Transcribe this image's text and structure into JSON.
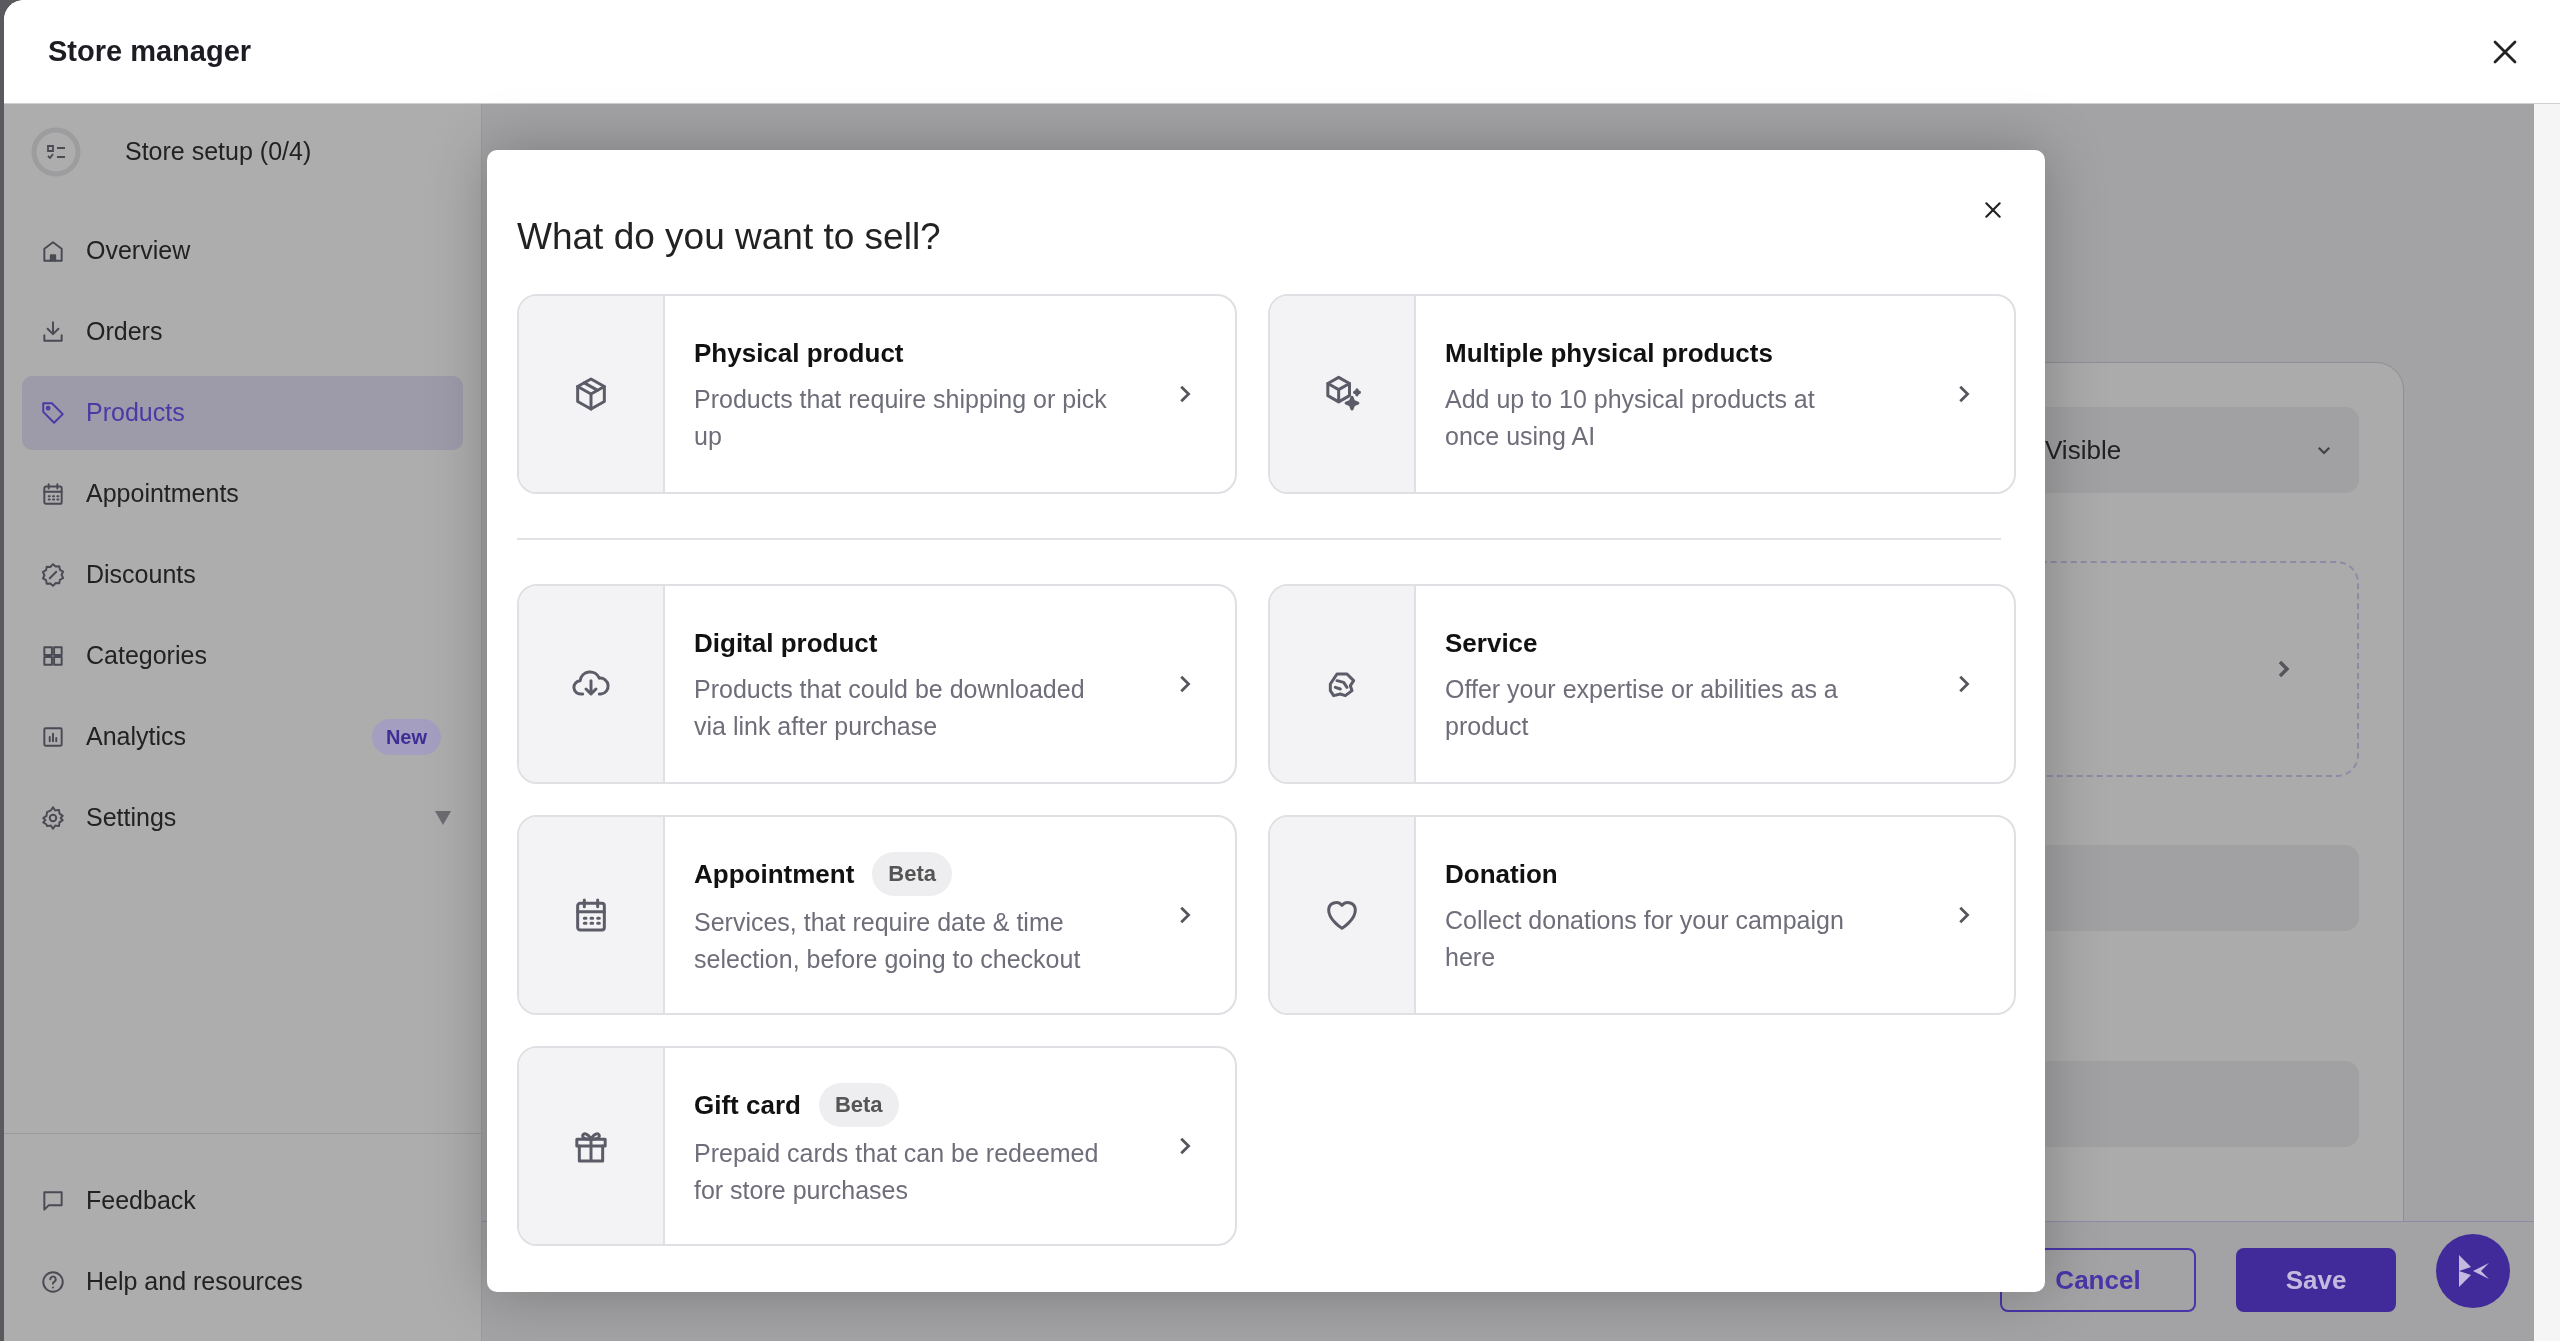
{
  "window": {
    "title": "Store manager"
  },
  "sidebar": {
    "setup": "Store setup (0/4)",
    "items": [
      {
        "label": "Overview",
        "selected": false
      },
      {
        "label": "Orders",
        "selected": false
      },
      {
        "label": "Products",
        "selected": true
      },
      {
        "label": "Appointments",
        "selected": false
      },
      {
        "label": "Discounts",
        "selected": false
      },
      {
        "label": "Categories",
        "selected": false
      },
      {
        "label": "Analytics",
        "selected": false,
        "badge": "New"
      },
      {
        "label": "Settings",
        "selected": false,
        "submenu": true
      }
    ],
    "footer_items": [
      {
        "label": "Feedback"
      },
      {
        "label": "Help and resources"
      }
    ]
  },
  "background": {
    "visibility_select": "Visible",
    "buttons": [
      "Cancel",
      "Save"
    ]
  },
  "modal": {
    "title": "What do you want to sell?",
    "options": [
      {
        "title": "Physical product",
        "description": "Products that require shipping or pick up"
      },
      {
        "title": "Multiple physical products",
        "description": "Add up to 10 physical products at once using AI"
      },
      {
        "title": "Digital product",
        "description": "Products that could be downloaded via link after purchase"
      },
      {
        "title": "Service",
        "description": "Offer your expertise or abilities as a product"
      },
      {
        "title": "Appointment",
        "badge": "Beta",
        "description": "Services, that require date & time selection, before going to checkout"
      },
      {
        "title": "Donation",
        "description": "Collect donations for your campaign here"
      },
      {
        "title": "Gift card",
        "badge": "Beta",
        "description": "Prepaid cards that can be redeemed for store purchases"
      }
    ]
  }
}
